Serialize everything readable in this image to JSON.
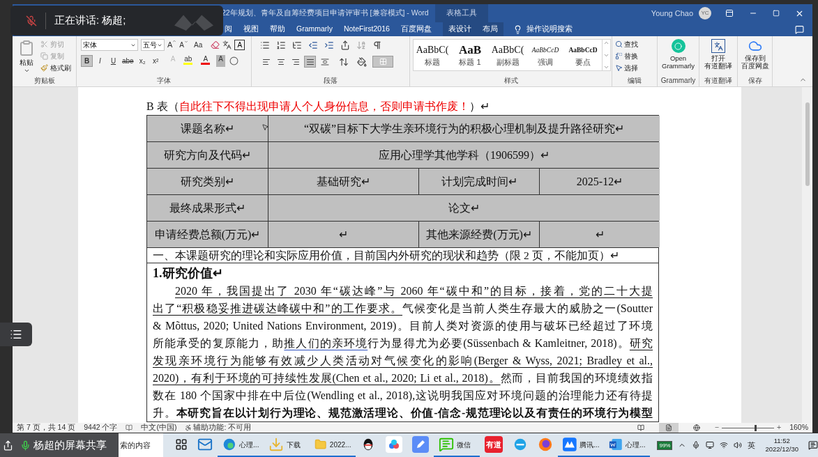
{
  "meeting_overlay": {
    "speaking": "正在讲话: 杨超;",
    "mic_muted": true,
    "share_label": "杨超的屏幕共享"
  },
  "window": {
    "title": "22年规划、青年及自筹经费项目申请评审书 [兼容模式]  -  Word",
    "context_tab": "表格工具",
    "user": "Young Chao",
    "avatar": "YC"
  },
  "tabs": [
    {
      "label": "阅",
      "selected": false,
      "context": false
    },
    {
      "label": "视图",
      "selected": false,
      "context": false
    },
    {
      "label": "帮助",
      "selected": false,
      "context": false
    },
    {
      "label": "Grammarly",
      "selected": false,
      "context": false
    },
    {
      "label": "NoteFirst2016",
      "selected": false,
      "context": false
    },
    {
      "label": "百度网盘",
      "selected": false,
      "context": false
    },
    {
      "label": "表设计",
      "selected": false,
      "context": true
    },
    {
      "label": "布局",
      "selected": false,
      "context": true
    }
  ],
  "tell_me": "操作说明搜索",
  "ribbon": {
    "clipboard": {
      "group": "剪贴板",
      "paste": "粘贴",
      "items": [
        {
          "kind": "cut",
          "label": "剪切",
          "disabled": true
        },
        {
          "kind": "copy",
          "label": "复制",
          "disabled": true
        },
        {
          "kind": "painter",
          "label": "格式刷",
          "disabled": false
        }
      ]
    },
    "font": {
      "group": "字体",
      "family": "宋体",
      "size": "五号",
      "sizers": [
        "A",
        "A"
      ],
      "case": "Aa",
      "char_border": "A",
      "buttons": [
        {
          "kind": "bold",
          "label": "B",
          "selected": true
        },
        {
          "kind": "italic",
          "label": "I",
          "selected": false
        },
        {
          "kind": "underline",
          "label": "U",
          "selected": false
        },
        {
          "kind": "strike",
          "label": "abe",
          "selected": false
        },
        {
          "kind": "sub",
          "label": "x₂",
          "selected": false
        },
        {
          "kind": "sup",
          "label": "x²",
          "selected": false
        }
      ],
      "tools": [
        {
          "kind": "effect",
          "label": "A"
        },
        {
          "kind": "highlight",
          "label": "ab"
        },
        {
          "kind": "color",
          "label": "A"
        },
        {
          "kind": "shading",
          "label": "A"
        }
      ]
    },
    "paragraph": {
      "group": "段落",
      "align": [
        {
          "kind": "left",
          "selected": false
        },
        {
          "kind": "center",
          "selected": false
        },
        {
          "kind": "right",
          "selected": false
        },
        {
          "kind": "justify",
          "selected": true
        },
        {
          "kind": "distributed",
          "selected": false
        }
      ]
    },
    "styles": {
      "group": "样式",
      "items": [
        {
          "kind": "title",
          "preview": "AaBbC(",
          "label": "标题"
        },
        {
          "kind": "heading",
          "preview": "AaB",
          "label": "标题 1"
        },
        {
          "kind": "subtitle",
          "preview": "AaBbC(",
          "label": "副标题"
        },
        {
          "kind": "emphasis",
          "preview": "AaBbCcD",
          "label": "强调"
        },
        {
          "kind": "strong",
          "preview": "AaBbCcD",
          "label": "要点"
        }
      ]
    },
    "editing": {
      "group": "编辑",
      "items": [
        {
          "kind": "find",
          "label": "查找"
        },
        {
          "kind": "replace",
          "label": "替换"
        },
        {
          "kind": "select",
          "label": "选择"
        }
      ]
    },
    "addins": [
      {
        "kind": "grammarly",
        "lines": [
          "Open",
          "Grammarly"
        ],
        "group": "Grammarly"
      },
      {
        "kind": "youdao",
        "lines": [
          "打开",
          "有道翻译"
        ],
        "group": "有道翻译"
      },
      {
        "kind": "baidu",
        "lines": [
          "保存到",
          "百度网盘"
        ],
        "group": "保存"
      }
    ]
  },
  "document": {
    "caption_prefix": "B 表（",
    "caption_warning": "自此往下不得出现申请人个人身份信息，否则申请书作废！",
    "caption_suffix": "）↵",
    "table": [
      {
        "kind": "pair",
        "cells": [
          "课题名称↵",
          "“双碳”目标下大学生亲环境行为的积极心理机制及提升路径研究↵"
        ]
      },
      {
        "kind": "pair",
        "cells": [
          "研究方向及代码↵",
          "应用心理学其他学科（1906599）↵"
        ]
      },
      {
        "kind": "quad",
        "cells": [
          "研究类别↵",
          "基础研究↵",
          "计划完成时间↵",
          "2025-12↵"
        ]
      },
      {
        "kind": "pair",
        "cells": [
          "最终成果形式↵",
          "论文↵"
        ]
      },
      {
        "kind": "quad",
        "cells": [
          "申请经费总额(万元)↵",
          "↵",
          "其他来源经费(万元)↵",
          "↵"
        ]
      }
    ],
    "section": "一、本课题研究的理论和实际应用价值，目前国内外研究的现状和趋势（限 2 页，不能加页）↵",
    "heading": "1.研究价值↵",
    "lines": [
      [
        {
          "text": "2020 年，我国提出了 2030 年“碳达峰”与 2060 年“碳中和”的目标，接着，党的二十大提",
          "kind": "underline"
        }
      ],
      [
        {
          "text": "出了“积极稳妥推进碳达峰碳中和”的工作要求。",
          "kind": "underline"
        },
        {
          "text": "气候变化是当前人类生存最大的威胁之一(Soutter",
          "kind": "plain"
        }
      ],
      [
        {
          "text": "& Mõttus, 2020; United Nations Environment, 2019)。目前人类对资源的使用与破坏已经超过了环境",
          "kind": "plain"
        }
      ],
      [
        {
          "text": "所能承受的复原能力，助",
          "kind": "plain"
        },
        {
          "text": "推人们的亲环境",
          "kind": "revision"
        },
        {
          "text": "行为显得尤为必要(Süssenbach & Kamleitner, 2018)。",
          "kind": "plain"
        },
        {
          "text": "研究",
          "kind": "underline"
        }
      ],
      [
        {
          "text": "发现亲环境行为能够有效减少人类活动对气候变化的影响(Berger & Wyss, 2021; Bradley et al.,",
          "kind": "underline"
        }
      ],
      [
        {
          "text": "2020)，有利于环境的可持续性发展(Chen et al., 2020; Li et al., 2018)。",
          "kind": "underline"
        },
        {
          "text": "然而，目前我国的环境绩效指",
          "kind": "plain"
        }
      ],
      [
        {
          "text": "数在 180 个国家中排在中后位(Wendling et al., 2018),这说明我国应对环境问题的治理能力还有待提",
          "kind": "plain"
        }
      ],
      [
        {
          "text": "升。",
          "kind": "plain"
        },
        {
          "text": "本研究旨在以计划行为理论、规范激活理论、价值-信念-规范理论以及有责任的环境行为模型",
          "kind": "bold"
        }
      ]
    ]
  },
  "status_bar": {
    "page": "第 7 页，共 14 页",
    "words": "9442 个字",
    "language": "中文(中国)",
    "accessibility": "辅助功能: 不可用",
    "views": [
      {
        "kind": "read",
        "selected": false
      },
      {
        "kind": "print",
        "selected": true
      },
      {
        "kind": "web",
        "selected": false
      }
    ],
    "zoom_minus": "−",
    "zoom_plus": "+",
    "zoom": {
      "level": 0.62
    },
    "zoom_text": "160%"
  },
  "taskbar": {
    "search_placeholder": "索的内容",
    "apps": [
      {
        "kind": "taskview",
        "running": false
      },
      {
        "kind": "mail",
        "running": false
      },
      {
        "kind": "edge",
        "label": "心理...",
        "running": true
      },
      {
        "kind": "downloads",
        "label": "下载",
        "running": true
      },
      {
        "kind": "folder",
        "label": "2022...",
        "running": true
      },
      {
        "kind": "qq",
        "running": false
      },
      {
        "kind": "netdisk",
        "running": false
      },
      {
        "kind": "notes",
        "running": false
      },
      {
        "kind": "wechat",
        "label": "微信",
        "running": true
      },
      {
        "kind": "youdao",
        "icon_text": "有道",
        "running": false
      },
      {
        "kind": "ie",
        "running": false
      },
      {
        "kind": "firefox",
        "running": false
      },
      {
        "kind": "meeting",
        "label": "腾讯...",
        "running": true
      },
      {
        "kind": "word",
        "label": "心理...",
        "running": true
      }
    ],
    "battery": "99%",
    "ime": "英",
    "time": "11:52",
    "date": "2022/12/30"
  }
}
